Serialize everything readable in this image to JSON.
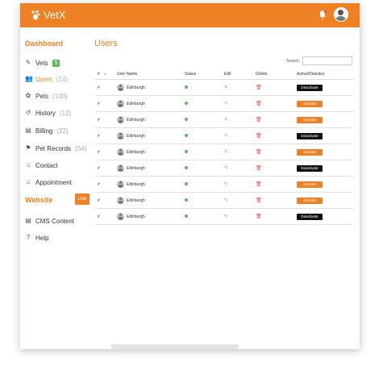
{
  "app": {
    "logo_text": "VetX",
    "accent": "#ef8125"
  },
  "sidebar": {
    "dashboard_label": "Dashboard",
    "website_label": "Website",
    "live_label": "Live",
    "items": [
      {
        "label": "Vets",
        "count": "",
        "badge": "5",
        "icon": "vets-icon"
      },
      {
        "label": "Users",
        "count": "(14)",
        "badge": "",
        "icon": "users-icon"
      },
      {
        "label": "Pets",
        "count": "(100)",
        "badge": "",
        "icon": "pets-icon"
      },
      {
        "label": "History",
        "count": "(12)",
        "badge": "",
        "icon": "history-icon"
      },
      {
        "label": "Billing",
        "count": "(22)",
        "badge": "",
        "icon": "billing-icon"
      },
      {
        "label": "Pet Records",
        "count": "(54)",
        "badge": "",
        "icon": "pet-records-icon"
      },
      {
        "label": "Contact",
        "count": "",
        "badge": "",
        "icon": "contact-icon"
      },
      {
        "label": "Appointment",
        "count": "",
        "badge": "",
        "icon": "appointment-icon"
      }
    ],
    "website_items": [
      {
        "label": "CMS Content",
        "icon": "cms-icon"
      },
      {
        "label": "Help",
        "icon": "help-icon"
      }
    ]
  },
  "main": {
    "title": "Users",
    "search_label": "Search:",
    "columns": [
      "#",
      "User Name",
      "Status",
      "Edit",
      "Delete",
      "Active/Deactive"
    ],
    "rows": [
      {
        "num": "#",
        "name": "Edinburgh",
        "action": "Deactivate"
      },
      {
        "num": "#",
        "name": "Edinburgh",
        "action": "Activate"
      },
      {
        "num": "#",
        "name": "Edinburgh",
        "action": "Activate"
      },
      {
        "num": "#",
        "name": "Edinburgh",
        "action": "Deactivate"
      },
      {
        "num": "#",
        "name": "Edinburgh",
        "action": "Activate"
      },
      {
        "num": "#",
        "name": "Edinburgh",
        "action": "Deactivate"
      },
      {
        "num": "#",
        "name": "Edinburgh",
        "action": "Activate"
      },
      {
        "num": "#",
        "name": "Edinburgh",
        "action": "Activate"
      },
      {
        "num": "#",
        "name": "Edinburgh",
        "action": "Deactivate"
      }
    ]
  }
}
